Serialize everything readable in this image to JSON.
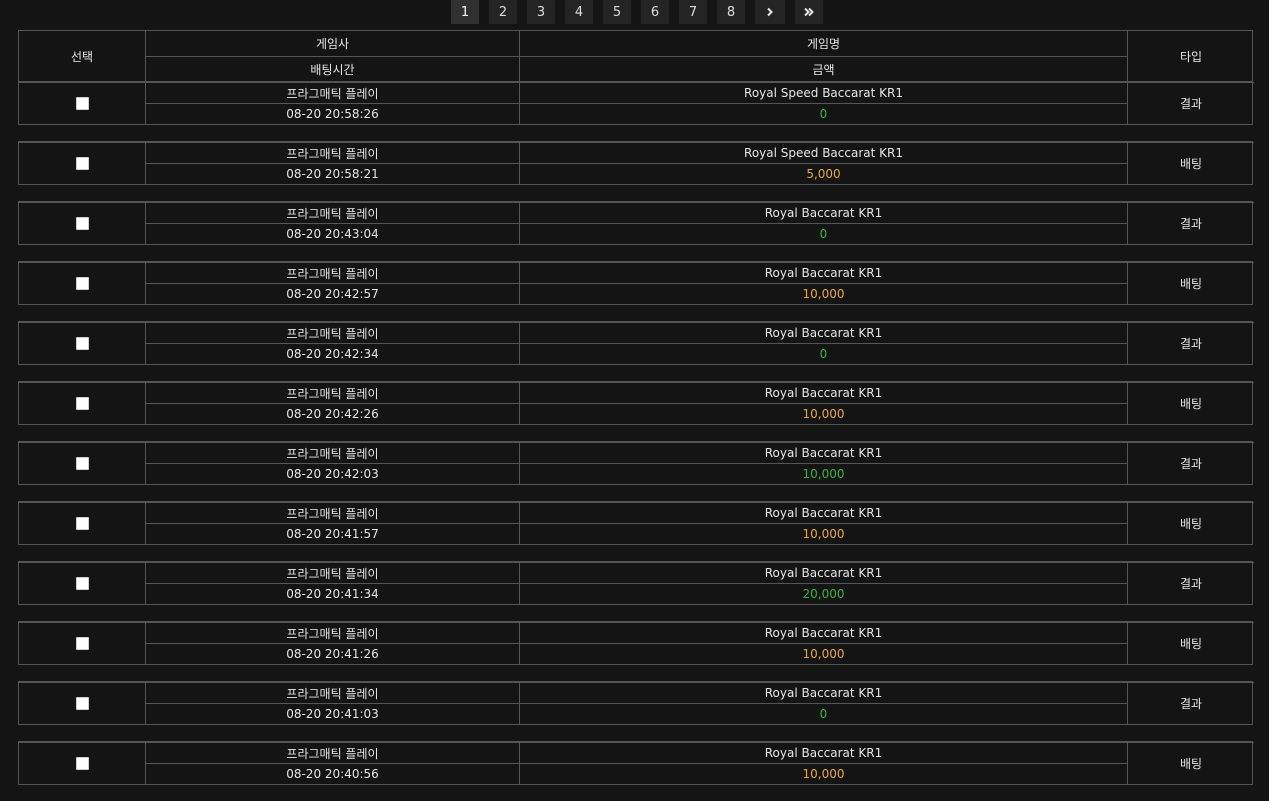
{
  "pagination": {
    "pages": [
      "1",
      "2",
      "3",
      "4",
      "5",
      "6",
      "7",
      "8"
    ],
    "active": "1",
    "next_icon": "chevron-right",
    "last_icon": "double-chevron-right"
  },
  "columns": {
    "select": "선택",
    "provider": "게임사",
    "game": "게임명",
    "type": "타입",
    "bet_time": "배팅시간",
    "amount": "금액"
  },
  "colors": {
    "green": "#3cb33c",
    "gold": "#e8a93a",
    "background": "#141414",
    "border": "#555555"
  },
  "rows": [
    {
      "provider": "프라그매틱 플레이",
      "game": "Royal Speed Baccarat KR1",
      "time": "08-20 20:58:26",
      "amount": "0",
      "type": "결과",
      "amount_color": "green"
    },
    {
      "provider": "프라그매틱 플레이",
      "game": "Royal Speed Baccarat KR1",
      "time": "08-20 20:58:21",
      "amount": "5,000",
      "type": "배팅",
      "amount_color": "gold"
    },
    {
      "provider": "프라그매틱 플레이",
      "game": "Royal Baccarat KR1",
      "time": "08-20 20:43:04",
      "amount": "0",
      "type": "결과",
      "amount_color": "green"
    },
    {
      "provider": "프라그매틱 플레이",
      "game": "Royal Baccarat KR1",
      "time": "08-20 20:42:57",
      "amount": "10,000",
      "type": "배팅",
      "amount_color": "gold"
    },
    {
      "provider": "프라그매틱 플레이",
      "game": "Royal Baccarat KR1",
      "time": "08-20 20:42:34",
      "amount": "0",
      "type": "결과",
      "amount_color": "green"
    },
    {
      "provider": "프라그매틱 플레이",
      "game": "Royal Baccarat KR1",
      "time": "08-20 20:42:26",
      "amount": "10,000",
      "type": "배팅",
      "amount_color": "gold"
    },
    {
      "provider": "프라그매틱 플레이",
      "game": "Royal Baccarat KR1",
      "time": "08-20 20:42:03",
      "amount": "10,000",
      "type": "결과",
      "amount_color": "green"
    },
    {
      "provider": "프라그매틱 플레이",
      "game": "Royal Baccarat KR1",
      "time": "08-20 20:41:57",
      "amount": "10,000",
      "type": "배팅",
      "amount_color": "gold"
    },
    {
      "provider": "프라그매틱 플레이",
      "game": "Royal Baccarat KR1",
      "time": "08-20 20:41:34",
      "amount": "20,000",
      "type": "결과",
      "amount_color": "green"
    },
    {
      "provider": "프라그매틱 플레이",
      "game": "Royal Baccarat KR1",
      "time": "08-20 20:41:26",
      "amount": "10,000",
      "type": "배팅",
      "amount_color": "gold"
    },
    {
      "provider": "프라그매틱 플레이",
      "game": "Royal Baccarat KR1",
      "time": "08-20 20:41:03",
      "amount": "0",
      "type": "결과",
      "amount_color": "green"
    },
    {
      "provider": "프라그매틱 플레이",
      "game": "Royal Baccarat KR1",
      "time": "08-20 20:40:56",
      "amount": "10,000",
      "type": "배팅",
      "amount_color": "gold"
    }
  ]
}
